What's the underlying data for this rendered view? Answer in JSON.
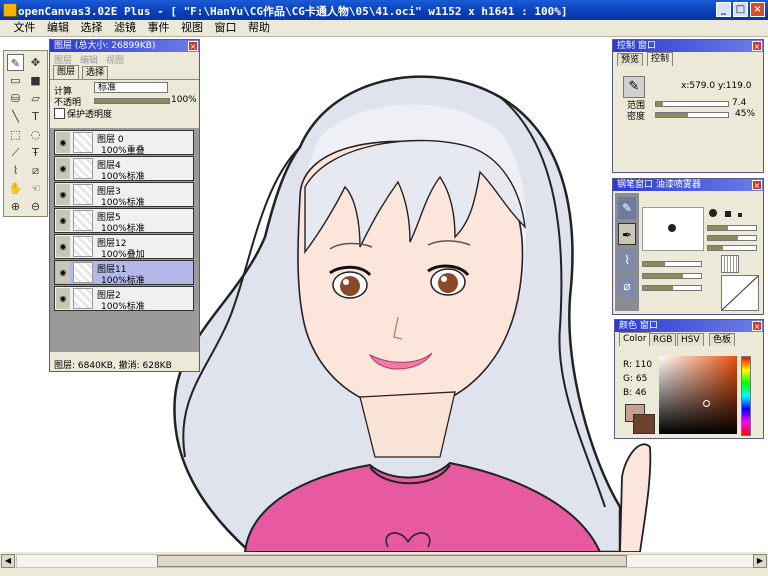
{
  "window": {
    "title": "openCanvas3.02E Plus - [ \"F:\\HanYu\\CG作品\\CG卡通人物\\05\\41.oci\" w1152 x h1641 : 100%]",
    "min_label": "_",
    "max_label": "□",
    "close_label": "×"
  },
  "menu": [
    "文件",
    "编辑",
    "选择",
    "滤镜",
    "事件",
    "视图",
    "窗口",
    "帮助"
  ],
  "tools": [
    {
      "icon": "pen-icon",
      "glyph": "✎"
    },
    {
      "icon": "move-icon",
      "glyph": "✥"
    },
    {
      "icon": "rect-outline-icon",
      "glyph": "▭"
    },
    {
      "icon": "rect-fill-icon",
      "glyph": "■"
    },
    {
      "icon": "bucket-icon",
      "glyph": "⛁"
    },
    {
      "icon": "eraser-icon",
      "glyph": "▱"
    },
    {
      "icon": "line-icon",
      "glyph": "╲"
    },
    {
      "icon": "text-icon",
      "glyph": "T"
    },
    {
      "icon": "rect-select-icon",
      "glyph": "⬚"
    },
    {
      "icon": "lasso-icon",
      "glyph": "◌"
    },
    {
      "icon": "wand-icon",
      "glyph": "⟋"
    },
    {
      "icon": "text-select-icon",
      "glyph": "Ŧ"
    },
    {
      "icon": "eyedropper-icon",
      "glyph": "⌇"
    },
    {
      "icon": "transform-icon",
      "glyph": "⧄"
    },
    {
      "icon": "hand-icon",
      "glyph": "✋"
    },
    {
      "icon": "rotate-hand-icon",
      "glyph": "☜"
    },
    {
      "icon": "zoom-in-icon",
      "glyph": "⊕"
    },
    {
      "icon": "zoom-out-icon",
      "glyph": "⊖"
    }
  ],
  "layers_panel": {
    "title": "图层 (总大小: 26899KB)",
    "menu": [
      "图层",
      "编辑",
      "视图"
    ],
    "tabs": [
      "图层",
      "选择"
    ],
    "calc_label": "计算",
    "blend_mode": "标准",
    "opacity_label": "不透明",
    "opacity_value": "100%",
    "opacity_fraction": 1.0,
    "protect_label": "保护透明度",
    "layers": [
      {
        "name": "图层 0",
        "mode": "100%重叠",
        "selected": false
      },
      {
        "name": "图层4",
        "mode": "100%标准",
        "selected": false
      },
      {
        "name": "图层3",
        "mode": "100%标准",
        "selected": false
      },
      {
        "name": "图层5",
        "mode": "100%标准",
        "selected": false
      },
      {
        "name": "图层12",
        "mode": "100%叠加",
        "selected": false
      },
      {
        "name": "图层11",
        "mode": "100%标准",
        "selected": true
      },
      {
        "name": "图层2",
        "mode": "100%标准",
        "selected": false
      }
    ],
    "status": "图层: 6840KB, 撤消: 628KB"
  },
  "control_panel": {
    "title": "控制 窗口",
    "tabs": [
      "预览",
      "控制"
    ],
    "coords": "x:579.0 y:119.0",
    "range_label": "范围",
    "range_value": "7.4",
    "range_fraction": 0.1,
    "density_label": "密度",
    "density_value": "45%",
    "density_fraction": 0.45
  },
  "brush_panel": {
    "title": "钢笔窗口 油漆喷雾器"
  },
  "color_panel": {
    "title": "颜色 窗口",
    "tabs": [
      "Color",
      "RGB",
      "HSV",
      "色板"
    ],
    "r_label": "R: 110",
    "g_label": "G: 65",
    "b_label": "B: 46",
    "fg_color": "#6e412e",
    "bg_color": "#c8a090"
  }
}
